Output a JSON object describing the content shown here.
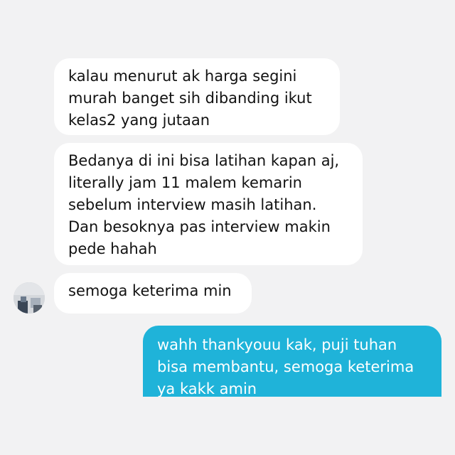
{
  "messages": [
    {
      "sender": "other",
      "text": "kalau menurut ak harga segini\nmurah banget sih dibanding ikut\nkelas2 yang jutaan"
    },
    {
      "sender": "other",
      "text": "Bedanya di ini bisa latihan kapan aj,\nliterally jam 11 malem kemarin\nsebelum interview masih latihan.\nDan besoknya pas interview makin\npede hahah"
    },
    {
      "sender": "other",
      "text": "semoga keterima min"
    },
    {
      "sender": "self",
      "text": "wahh thankyouu kak, puji tuhan\nbisa membantu, semoga keterima\nya kakk amin"
    }
  ],
  "colors": {
    "background": "#f2f2f3",
    "incoming_bubble": "#ffffff",
    "outgoing_bubble": "#1fb3d9",
    "text_dark": "#121212",
    "text_light": "#ffffff"
  },
  "icons": {
    "avatar": "user-avatar-photo"
  }
}
